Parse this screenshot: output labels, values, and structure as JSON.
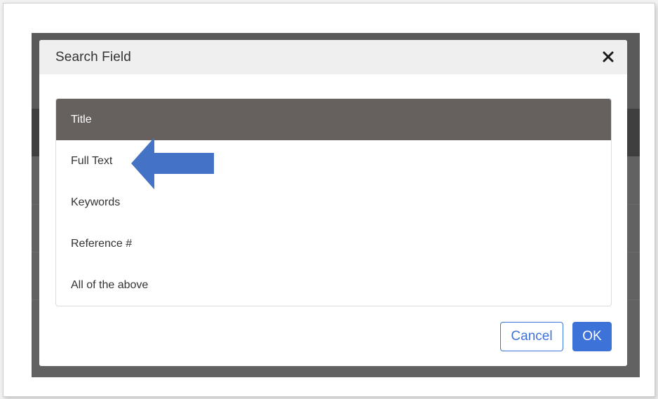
{
  "dialog": {
    "title": "Search Field",
    "close_icon": "close-icon"
  },
  "options": [
    {
      "label": "Title",
      "selected": true
    },
    {
      "label": "Full Text",
      "selected": false
    },
    {
      "label": "Keywords",
      "selected": false
    },
    {
      "label": "Reference #",
      "selected": false
    },
    {
      "label": "All of the above",
      "selected": false
    }
  ],
  "annotation": {
    "icon": "left-arrow-icon",
    "color": "#4472c4",
    "points_to": "Full Text"
  },
  "buttons": {
    "cancel_label": "Cancel",
    "ok_label": "OK"
  },
  "colors": {
    "selected_row": "#66605e",
    "accent": "#3d72d8",
    "header_bg": "#efefef"
  }
}
